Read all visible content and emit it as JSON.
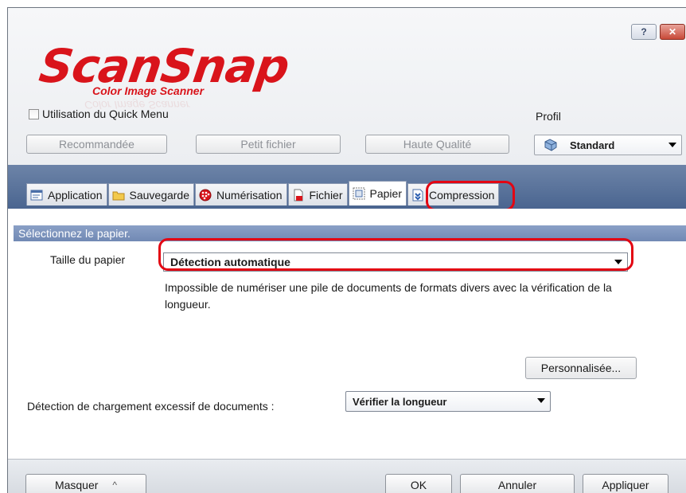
{
  "window": {
    "help_label": "?",
    "close_label": "✕"
  },
  "logo": {
    "brand": "ScanSnap",
    "subtitle": "Color Image Scanner"
  },
  "quick_menu": {
    "label": "Utilisation du Quick Menu",
    "checked": false
  },
  "profile": {
    "label": "Profil",
    "selected": "Standard"
  },
  "presets": [
    "Recommandée",
    "Petit fichier",
    "Haute Qualité"
  ],
  "tabs": [
    {
      "label": "Application",
      "icon": "application-icon"
    },
    {
      "label": "Sauvegarde",
      "icon": "folder-icon"
    },
    {
      "label": "Numérisation",
      "icon": "scan-color-icon"
    },
    {
      "label": "Fichier",
      "icon": "file-icon"
    },
    {
      "label": "Papier",
      "icon": "paper-icon",
      "active": true
    },
    {
      "label": "Compression",
      "icon": "compression-icon"
    }
  ],
  "paper_panel": {
    "section_title": "Sélectionnez le papier.",
    "paper_size_label": "Taille du papier",
    "paper_size_value": "Détection automatique",
    "warning_text": "Impossible de numériser une pile de documents de formats divers avec la vérification de la longueur.",
    "custom_button": "Personnalisée...",
    "overload_label": "Détection de chargement excessif de documents :",
    "overload_value": "Vérifier la longueur"
  },
  "footer": {
    "hide_button": "Masquer",
    "hide_arrow": "^",
    "ok": "OK",
    "cancel": "Annuler",
    "apply": "Appliquer"
  },
  "colors": {
    "accent_red": "#e30613",
    "logo_red": "#d9141b",
    "tab_bar": "#5a7299",
    "section_header": "#7c93bd"
  }
}
